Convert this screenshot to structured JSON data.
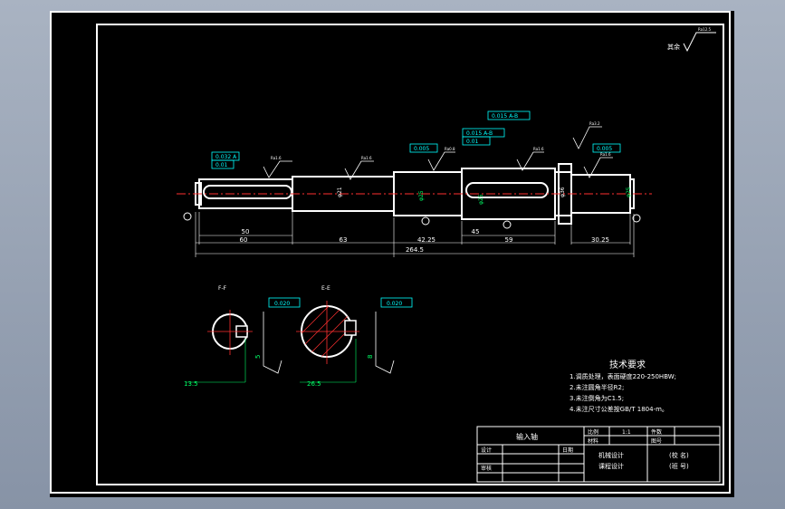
{
  "surface_finish": {
    "label": "其余",
    "value": "Ra12.5"
  },
  "dimensions": {
    "d50": "50",
    "d60": "60",
    "d63": "63",
    "d4225": "42.25",
    "d45": "45",
    "d59": "59",
    "d3025": "30.25",
    "d2645": "264.5",
    "phi21": "φ21",
    "phi25a": "φ25",
    "phi25b": "φ25",
    "phi36": "φ36",
    "phi25c": "φ25"
  },
  "tolerance_frames": {
    "f1": "0.032 A",
    "f2": "0.01",
    "f3": "0.005",
    "f4": "0.015 A-B",
    "f5": "0.015 A-B",
    "f6": "0.01",
    "f7": "0.005",
    "f8": "0.020",
    "f9": "0.020"
  },
  "roughness_marks": {
    "r1": "Ra1.6",
    "r2": "Ra1.6",
    "r3": "Ra0.8",
    "r4": "Ra1.6",
    "r5": "Ra3.2",
    "r6": "Ra1.6"
  },
  "section_labels": {
    "ff": "F-F",
    "ee": "E-E",
    "e_sec": "13.5",
    "e_sec2": "26.5",
    "w1": "5",
    "w2": "8"
  },
  "tech_requirements": {
    "title": "技术要求",
    "items": [
      "1.调质处理，表面硬度220-250HBW;",
      "2.未注圆角半径R2;",
      "3.未注倒角为C1.5;",
      "4.未注尺寸公差按GB/T 1804-m。"
    ]
  },
  "title_block": {
    "part_name": "输入轴",
    "scale_label": "比例",
    "scale_value": "1:1",
    "material_label": "材料",
    "qty_label": "件数",
    "drawing_no_label": "图号",
    "design_label": "设计",
    "check_label": "审核",
    "date_label": "日期",
    "course_line1": "机械设计",
    "course_line2": "课程设计",
    "school_line1": "(校 名)",
    "school_line2": "(班 号)"
  },
  "colors": {
    "line": "#ffffff",
    "dim": "#00ff66",
    "annot": "#00ffff",
    "center": "#ff3030"
  }
}
